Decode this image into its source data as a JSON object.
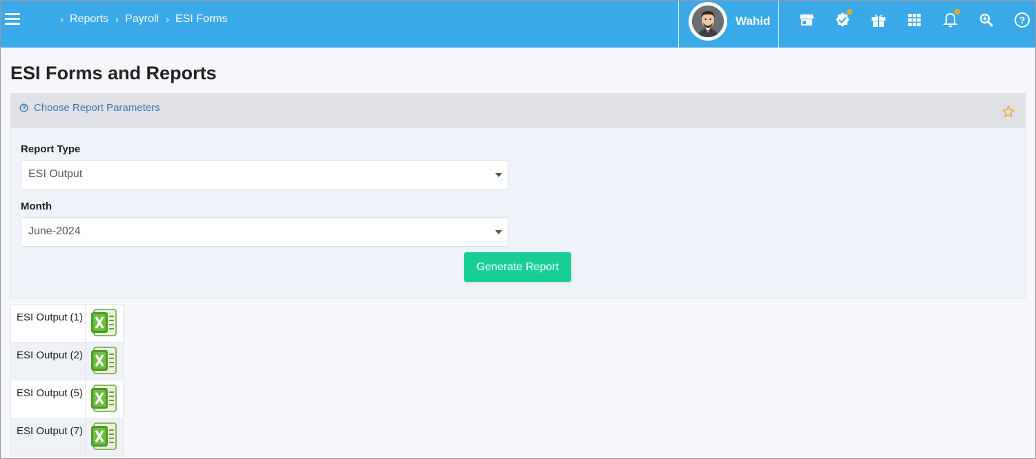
{
  "breadcrumb": [
    "Reports",
    "Payroll",
    "ESI Forms"
  ],
  "user": {
    "name": "Wahid"
  },
  "topbar_icons": [
    "store-icon",
    "verified-badge-icon",
    "gift-icon",
    "apps-grid-icon",
    "bell-icon",
    "search-zoom-icon",
    "help-icon"
  ],
  "page": {
    "title": "ESI Forms and Reports"
  },
  "panel": {
    "title": "Choose Report Parameters",
    "report_type_label": "Report Type",
    "report_type_value": "ESI Output",
    "month_label": "Month",
    "month_value": "June-2024",
    "generate_label": "Generate Report"
  },
  "results": [
    {
      "name": "ESI Output (1)"
    },
    {
      "name": "ESI Output (2)"
    },
    {
      "name": "ESI Output (5)"
    },
    {
      "name": "ESI Output (7)"
    }
  ],
  "colors": {
    "topbar": "#3aa9e9",
    "accent_green": "#17cf95",
    "link_blue": "#3c78b4",
    "star": "#f5a623"
  }
}
